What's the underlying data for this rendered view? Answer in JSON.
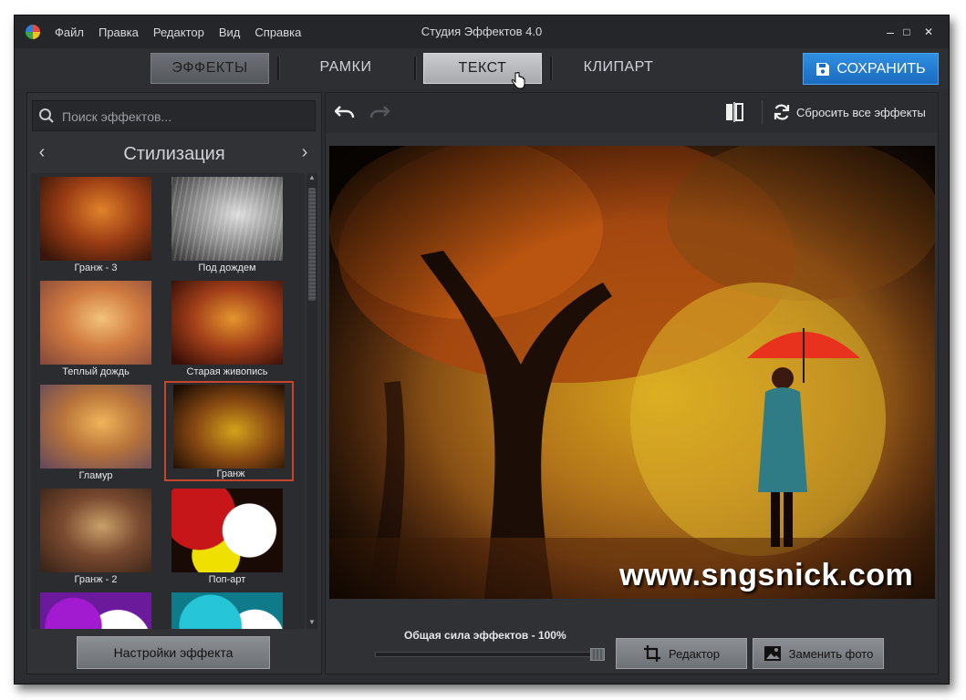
{
  "menu": [
    "Файл",
    "Правка",
    "Редактор",
    "Вид",
    "Справка"
  ],
  "window": {
    "title": "Студия Эффектов 4.0",
    "minimize": "–",
    "maximize": "□",
    "close": "✕"
  },
  "tabs": [
    {
      "label": "ЭФФЕКТЫ",
      "state": "active"
    },
    {
      "label": "РАМКИ",
      "state": "normal"
    },
    {
      "label": "ТЕКСТ",
      "state": "hover"
    },
    {
      "label": "КЛИПАРТ",
      "state": "normal"
    }
  ],
  "save_label": "СОХРАНИТЬ",
  "search": {
    "placeholder": "Поиск эффектов..."
  },
  "category": {
    "title": "Стилизация",
    "prev": "‹",
    "next": "›"
  },
  "effects": [
    {
      "label": "Гранж - 3",
      "selected": false
    },
    {
      "label": "Под дождем",
      "selected": false
    },
    {
      "label": "Теплый дождь",
      "selected": false
    },
    {
      "label": "Старая живопись",
      "selected": false
    },
    {
      "label": "Гламур",
      "selected": false
    },
    {
      "label": "Гранж",
      "selected": true
    },
    {
      "label": "Гранж - 2",
      "selected": false
    },
    {
      "label": "Поп-арт",
      "selected": false
    }
  ],
  "effect_settings_label": "Настройки эффекта",
  "reset_label": "Сбросить все эффекты",
  "photo_watermark": "www.sngsnick.com",
  "strength_label": "Общая сила эффектов - 100%",
  "strength_value": 100,
  "editor_label": "Редактор",
  "replace_photo_label": "Заменить фото",
  "colors": {
    "accent_blue": "#1f7ad0",
    "selection": "#c8452a",
    "window_bg": "#2b2d31"
  }
}
